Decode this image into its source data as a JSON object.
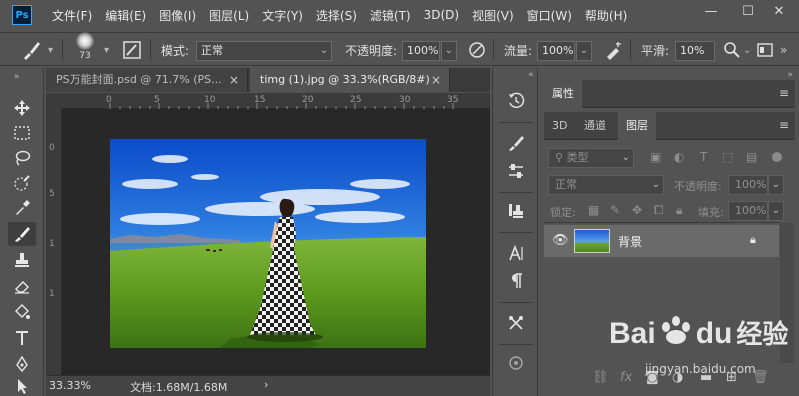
{
  "app": {
    "logo": "Ps"
  },
  "menu": [
    "文件(F)",
    "编辑(E)",
    "图像(I)",
    "图层(L)",
    "文字(Y)",
    "选择(S)",
    "滤镜(T)",
    "3D(D)",
    "视图(V)",
    "窗口(W)",
    "帮助(H)"
  ],
  "window_controls": {
    "minimize": "—",
    "maximize": "☐",
    "close": "✕"
  },
  "options": {
    "brush_size": "73",
    "mode_label": "模式:",
    "mode_value": "正常",
    "opacity_label": "不透明度:",
    "opacity_value": "100%",
    "flow_label": "流量:",
    "flow_value": "100%",
    "smooth_label": "平滑:",
    "smooth_value": "10%"
  },
  "tabs": [
    {
      "label": "PS万能封面.psd @ 71.7% (PS...",
      "close": "×"
    },
    {
      "label": "timg (1).jpg @ 33.3%(RGB/8#)",
      "close": "×"
    }
  ],
  "ruler": {
    "top_ticks": [
      "0",
      "5",
      "10",
      "15",
      "20",
      "25",
      "30",
      "35"
    ],
    "left_ticks": [
      "0",
      "5",
      "1",
      "1"
    ]
  },
  "status": {
    "zoom": "33.33%",
    "doc": "文档:1.68M/1.68M",
    "arrow": "›"
  },
  "panels": {
    "properties_tab": "属性",
    "tabs": [
      "3D",
      "通道",
      "图层"
    ],
    "active_tab": "图层",
    "filter_kind": "类型",
    "blend_mode": "正常",
    "opacity_label": "不透明度:",
    "opacity_value": "100%",
    "lock_label": "锁定:",
    "fill_label": "填充:",
    "fill_value": "100%",
    "layer_name": "背景"
  },
  "watermark": {
    "brand": "Bai",
    "brand2": "du",
    "cn": "经验",
    "url": "jingyan.baidu.com"
  },
  "colors": {
    "accent": "#31a8ff",
    "ui_bg": "#535353",
    "canvas_bg": "#282828",
    "active_row": "#6a6a6a"
  }
}
